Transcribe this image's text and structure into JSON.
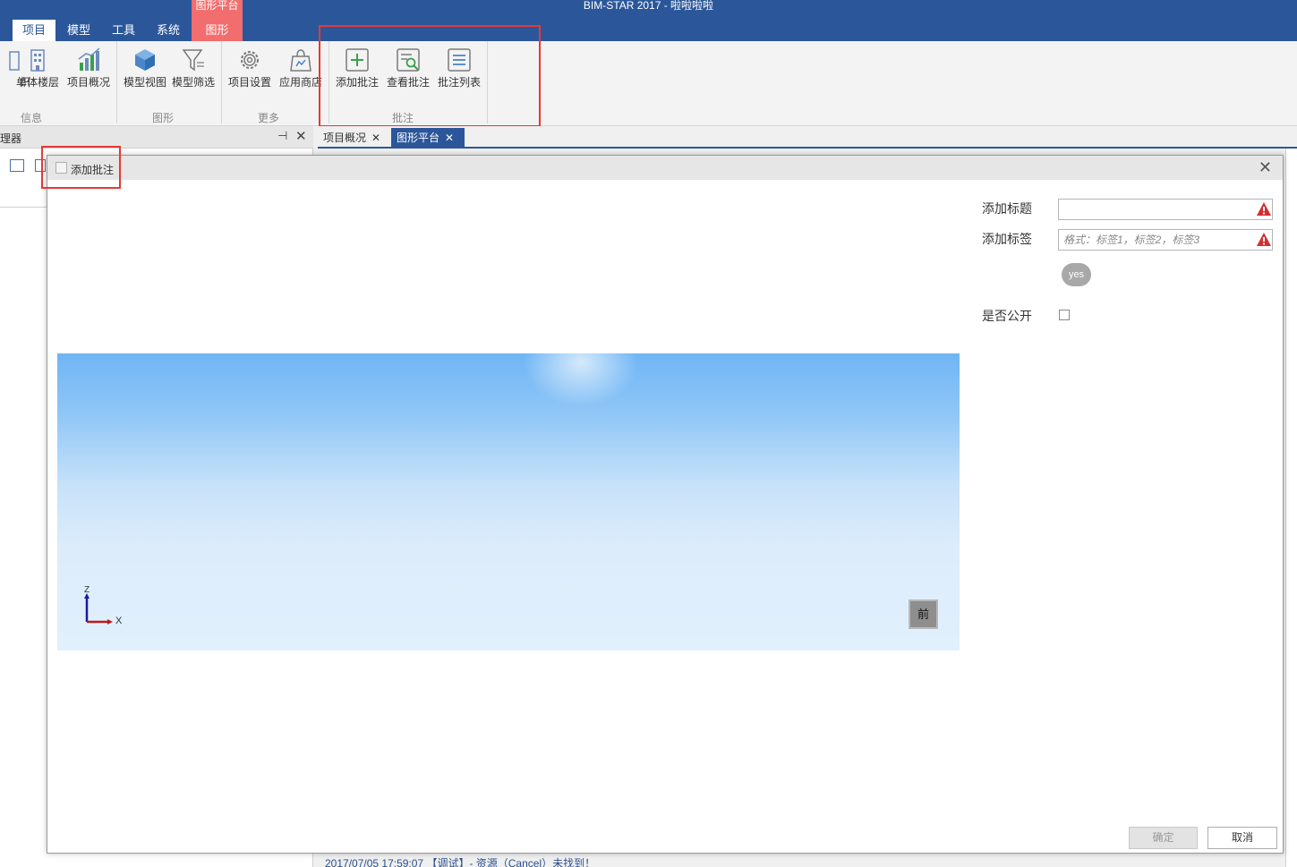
{
  "app": {
    "title": "BIM-STAR 2017 - 啦啦啦啦",
    "context_group": "图形平台"
  },
  "menu": {
    "tabs": [
      {
        "label": "项目",
        "active": true
      },
      {
        "label": "模型"
      },
      {
        "label": "工具"
      },
      {
        "label": "系统"
      },
      {
        "label": "图形",
        "contextual": true
      }
    ]
  },
  "ribbon": {
    "buttons": [
      {
        "label": "织",
        "icon": "organization-icon"
      },
      {
        "label": "单体楼层",
        "icon": "building-icon"
      },
      {
        "label": "项目概况",
        "icon": "bar-chart-icon"
      },
      {
        "label": "模型视图",
        "icon": "cube-icon"
      },
      {
        "label": "模型筛选",
        "icon": "filter-icon"
      },
      {
        "label": "项目设置",
        "icon": "gear-icon"
      },
      {
        "label": "应用商店",
        "icon": "store-bag-icon"
      },
      {
        "label": "添加批注",
        "icon": "add-annotation-icon"
      },
      {
        "label": "查看批注",
        "icon": "view-annotation-icon"
      },
      {
        "label": "批注列表",
        "icon": "list-icon"
      }
    ],
    "groups": [
      {
        "label": "信息"
      },
      {
        "label": "图形"
      },
      {
        "label": "更多"
      },
      {
        "label": "批注"
      }
    ]
  },
  "left_pane": {
    "title": "理器"
  },
  "doc_tabs": [
    {
      "label": "项目概况",
      "active": false
    },
    {
      "label": "图形平台",
      "active": true
    }
  ],
  "dialog": {
    "title": "添加批注",
    "form": {
      "title_label": "添加标题",
      "title_value": "",
      "tags_label": "添加标签",
      "tags_placeholder": "格式：标签1，标签2，标签3",
      "tag_chip": "yes",
      "public_label": "是否公开",
      "public_checked": false
    },
    "viewport": {
      "axis_z": "Z",
      "axis_x": "X",
      "view_button": "前"
    },
    "buttons": {
      "ok": "确定",
      "cancel": "取消"
    }
  },
  "log": {
    "line": "2017/07/05 17:59:07 【调试】- 资源（Cancel）未找到！"
  },
  "colors": {
    "accent": "#2b579a",
    "context_tab": "#f26d6d",
    "highlight_box": "#e53935",
    "warning": "#d32f2f"
  }
}
